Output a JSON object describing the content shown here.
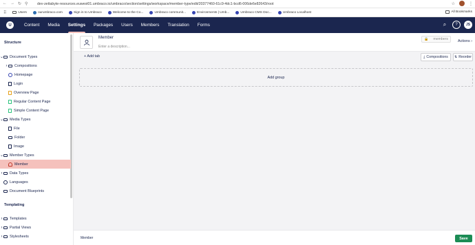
{
  "browser": {
    "url": "dev-zettabyte-resources.euwest01.umbraco.io/umbraco/section/settings/workspace/member-type/edit/20377460-61c9-4dc1-bcd6-006de6e82643/root",
    "bookmarks": [
      "Users",
      "ourumbraco.com",
      "Sign in to Umbraco",
      "Welcome to the Co...",
      "Umbraco communit...",
      "Environments | Umb...",
      "Umbraco CMS Doc...",
      "Umbraco Localhost"
    ],
    "all_bookmarks": "All Bookmarks"
  },
  "topnav": {
    "sections": [
      "Content",
      "Media",
      "Settings",
      "Packages",
      "Users",
      "Members",
      "Translation",
      "Forms"
    ],
    "active": "Settings",
    "user_initials": "JS",
    "help": "?"
  },
  "sidebar": {
    "structure_title": "Structure",
    "templating_title": "Templating",
    "items": [
      {
        "label": "Document Types",
        "icon": "folder-icon",
        "level": 0,
        "expanded": true
      },
      {
        "label": "Compositions",
        "icon": "folder-icon",
        "level": 1,
        "expandable": true
      },
      {
        "label": "Homepage",
        "icon": "home-icon",
        "level": 1
      },
      {
        "label": "Login",
        "icon": "lock-icon",
        "level": 1
      },
      {
        "label": "Overview Page",
        "icon": "document-icon",
        "level": 1
      },
      {
        "label": "Regular Content Page",
        "icon": "document-icon",
        "level": 1
      },
      {
        "label": "Simple Content Page",
        "icon": "document-icon",
        "level": 1
      },
      {
        "label": "Media Types",
        "icon": "folder-icon",
        "level": 0,
        "expanded": true
      },
      {
        "label": "File",
        "icon": "file-icon",
        "level": 1
      },
      {
        "label": "Folder",
        "icon": "folder-icon",
        "level": 1
      },
      {
        "label": "Image",
        "icon": "image-icon",
        "level": 1
      },
      {
        "label": "Member Types",
        "icon": "folder-icon",
        "level": 0,
        "expanded": true
      },
      {
        "label": "Member",
        "icon": "user-icon",
        "level": 1,
        "selected": true
      },
      {
        "label": "Data Types",
        "icon": "folder-icon",
        "level": 0,
        "expandable": true
      },
      {
        "label": "Languages",
        "icon": "globe-icon",
        "level": 0
      },
      {
        "label": "Document Blueprints",
        "icon": "folder-icon",
        "level": 0
      }
    ],
    "templating_items": [
      {
        "label": "Templates",
        "icon": "folder-icon"
      },
      {
        "label": "Partial Views",
        "icon": "folder-icon"
      },
      {
        "label": "Stylesheets",
        "icon": "folder-icon"
      }
    ]
  },
  "workspace": {
    "name_value": "Member",
    "description_placeholder": "Enter a description...",
    "alias_value": "members",
    "actions_label": "Actions",
    "add_tab_label": "Add tab",
    "compositions_label": "Compositions",
    "reorder_label": "Reorder",
    "add_group_label": "Add group",
    "breadcrumb": "Member",
    "save_label": "Save"
  },
  "colors": {
    "nav_bg": "#1b264f",
    "selected_bg": "#f5c1bc",
    "save_bg": "#1c8c55",
    "workspace_bg": "#f3f3f5"
  }
}
